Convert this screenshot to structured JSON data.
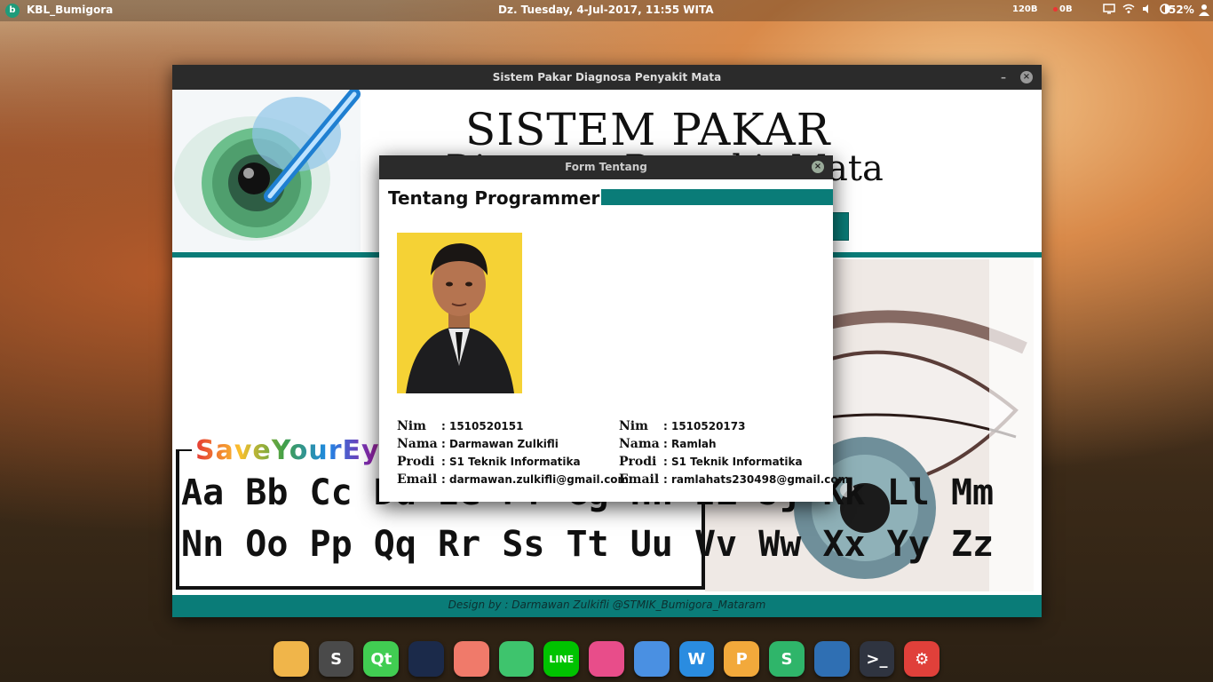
{
  "top_panel": {
    "app_icon": "bumigora-logo-icon",
    "app_name": "KBL_Bumigora",
    "clock": "Dz. Tuesday,  4-Jul-2017, 11:55 WITA",
    "net_up": "120B",
    "net_down": "0B",
    "battery": "52%"
  },
  "main_window": {
    "title": "Sistem Pakar Diagnosa Penyakit Mata",
    "minimize_label": "–",
    "close_label": "×",
    "header_title": "SISTEM PAKAR",
    "header_subtitle": "Diagnosa Penyakit Mata",
    "save_eyes_title": "SaveYourEyes",
    "alphabet_row1": "Aa Bb Cc Dd Ee Ff Gg Hh Ii Jj Kk Ll Mm",
    "alphabet_row2": "Nn Oo Pp Qq Rr Ss Tt Uu Vv Ww Xx Yy Zz",
    "footer": "Design by : Darmawan Zulkifli @STMIK_Bumigora_Mataram"
  },
  "dialog": {
    "title": "Form Tentang",
    "close_label": "×",
    "heading": "Tentang Programmer",
    "labels": {
      "nim": "Nim",
      "nama": "Nama",
      "prodi": "Prodi",
      "email": "Email"
    },
    "programmer1": {
      "nim": ": 1510520151",
      "nama": ": Darmawan Zulkifli",
      "prodi": ": S1 Teknik Informatika",
      "email": ": darmawan.zulkifli@gmail.com"
    },
    "programmer2": {
      "nim": ": 1510520173",
      "nama": ": Ramlah",
      "prodi": ": S1 Teknik Informatika",
      "email": ": ramlahats230498@gmail.com"
    }
  },
  "dock": [
    {
      "name": "files",
      "color": "#f0b54a",
      "glyph": ""
    },
    {
      "name": "sublime-text",
      "color": "#4a4a4a",
      "glyph": "S"
    },
    {
      "name": "qt-creator",
      "color": "#41cd52",
      "glyph": "Qt"
    },
    {
      "name": "mysql-workbench",
      "color": "#1b2a4a",
      "glyph": ""
    },
    {
      "name": "inkscape",
      "color": "#f07a6a",
      "glyph": ""
    },
    {
      "name": "screenshot",
      "color": "#3ec46d",
      "glyph": ""
    },
    {
      "name": "line",
      "color": "#00c300",
      "glyph": "LINE"
    },
    {
      "name": "telegram",
      "color": "#e84d8a",
      "glyph": ""
    },
    {
      "name": "chromium",
      "color": "#4a90e2",
      "glyph": ""
    },
    {
      "name": "wps-writer",
      "color": "#2a8ce0",
      "glyph": "W"
    },
    {
      "name": "wps-presentation",
      "color": "#f2a93b",
      "glyph": "P"
    },
    {
      "name": "wps-spreadsheets",
      "color": "#2fb56a",
      "glyph": "S"
    },
    {
      "name": "downloader",
      "color": "#2f6fb3",
      "glyph": ""
    },
    {
      "name": "terminal",
      "color": "#2f3440",
      "glyph": ">_"
    },
    {
      "name": "settings",
      "color": "#e0403a",
      "glyph": "⚙"
    }
  ]
}
